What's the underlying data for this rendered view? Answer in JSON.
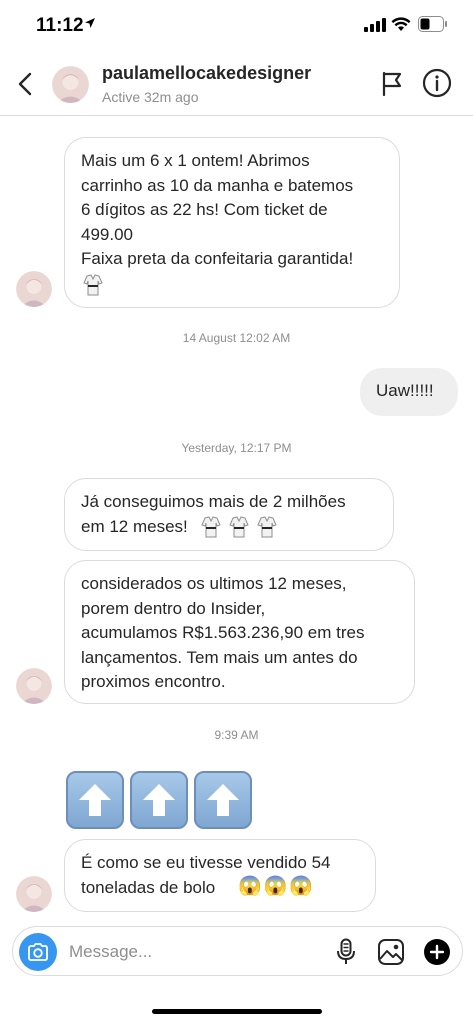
{
  "status_bar": {
    "time": "11:12"
  },
  "header": {
    "username": "paulamellocakedesigner",
    "status": "Active 32m ago"
  },
  "messages": {
    "m1": "Mais um 6 x 1 ontem! Abrimos\ncarrinho as 10 da manha e batemos\n6 dígitos as 22 hs! Com ticket de\n499.00\nFaixa preta da confeitaria garantida!",
    "ts1": "14 August 12:02 AM",
    "m2": "Uaw!!!!!",
    "ts2": "Yesterday, 12:17 PM",
    "m3": "Já conseguimos mais de 2 milhões\nem 12 meses!",
    "m4": "considerados os ultimos 12 meses,\nporem dentro do Insider,\nacumulamos R$1.563.236,90 em tres\nlançamentos. Tem mais um antes do\nproximos encontro.",
    "ts3": "9:39 AM",
    "m5": "É como se eu tivesse vendido 54\ntoneladas de bolo",
    "m5_emoji": "😱😱😱"
  },
  "composer": {
    "placeholder": "Message..."
  },
  "colors": {
    "accent": "#3797f0",
    "bubble_border": "#dbdbdb",
    "my_bubble": "#efefef",
    "muted_text": "#8e8e8e"
  }
}
